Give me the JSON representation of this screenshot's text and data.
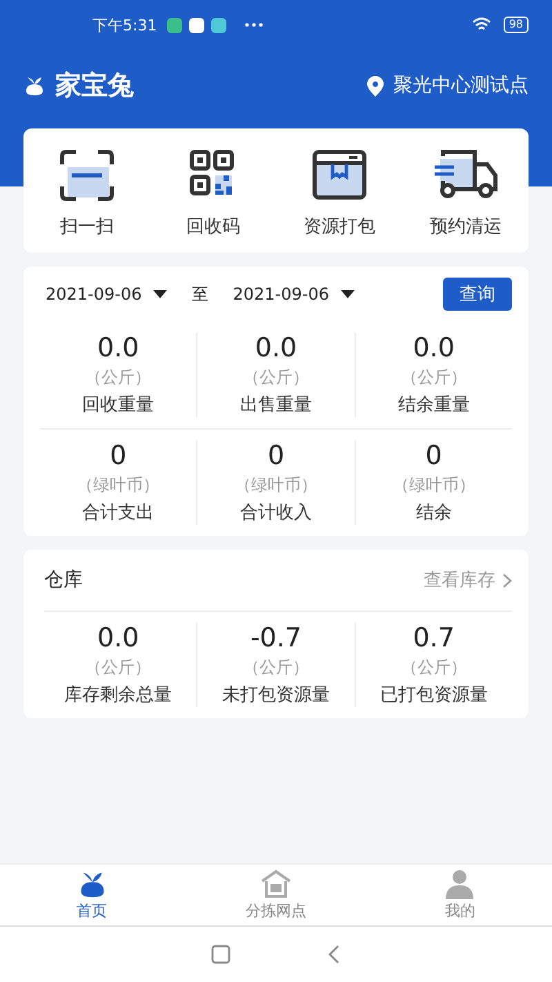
{
  "status_bar": {
    "time": "下午5:31",
    "battery": "98"
  },
  "header": {
    "app_name": "家宝兔",
    "location": "聚光中心测试点"
  },
  "actions": [
    {
      "kind": "scan",
      "label": "扫一扫"
    },
    {
      "kind": "qr",
      "label": "回收码"
    },
    {
      "kind": "package",
      "label": "资源打包"
    },
    {
      "kind": "truck",
      "label": "预约清运"
    }
  ],
  "filter": {
    "start_date": "2021-09-06",
    "separator": "至",
    "end_date": "2021-09-06",
    "query_button": "查询"
  },
  "stats": [
    [
      {
        "value": "0.0",
        "unit": "（公斤）",
        "label": "回收重量"
      },
      {
        "value": "0.0",
        "unit": "（公斤）",
        "label": "出售重量"
      },
      {
        "value": "0.0",
        "unit": "（公斤）",
        "label": "结余重量"
      }
    ],
    [
      {
        "value": "0",
        "unit": "（绿叶币）",
        "label": "合计支出"
      },
      {
        "value": "0",
        "unit": "（绿叶币）",
        "label": "合计收入"
      },
      {
        "value": "0",
        "unit": "（绿叶币）",
        "label": "结余"
      }
    ]
  ],
  "warehouse": {
    "title": "仓库",
    "link": "查看库存",
    "stats": [
      {
        "value": "0.0",
        "unit": "（公斤）",
        "label": "库存剩余总量"
      },
      {
        "value": "-0.7",
        "unit": "（公斤）",
        "label": "未打包资源量"
      },
      {
        "value": "0.7",
        "unit": "（公斤）",
        "label": "已打包资源量"
      }
    ]
  },
  "tab_bar": [
    {
      "kind": "home",
      "label": "首页",
      "selected": true
    },
    {
      "kind": "station",
      "label": "分拣网点",
      "selected": false
    },
    {
      "kind": "profile",
      "label": "我的",
      "selected": false
    }
  ]
}
